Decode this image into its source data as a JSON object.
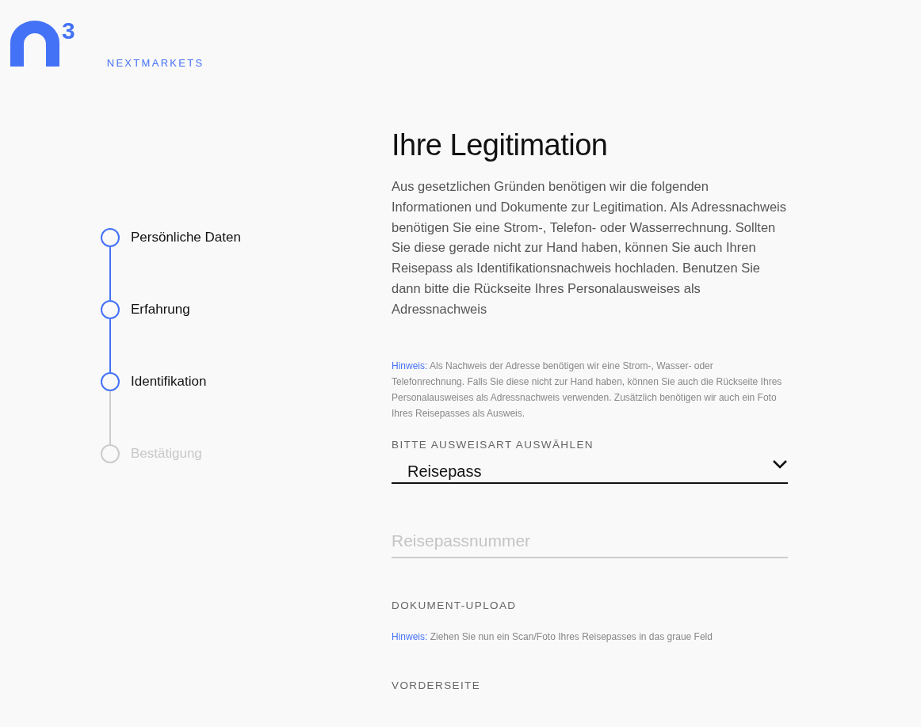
{
  "logo": {
    "superscript": "3",
    "wordmark": "NEXTMARKETS"
  },
  "steps": [
    {
      "label": "Persönliche Daten",
      "completed": true
    },
    {
      "label": "Erfahrung",
      "completed": true
    },
    {
      "label": "Identifikation",
      "completed": true
    },
    {
      "label": "Bestätigung",
      "completed": false
    }
  ],
  "title": "Ihre Legitimation",
  "intro": "Aus gesetzlichen Gründen benötigen wir die folgenden Informationen und Dokumente zur Legitimation. Als Adressnachweis benötigen Sie eine Strom-, Telefon- oder Wasserrechnung. Sollten Sie diese gerade nicht zur Hand haben, können Sie auch Ihren Reisepass als Identifikationsnachweis hochladen. Benutzen Sie dann bitte die Rückseite Ihres Personalausweises als Adressnachweis",
  "hint": {
    "label": "Hinweis:",
    "text": "Als Nachweis der Adresse benötigen wir eine Strom-, Wasser- oder Telefonrechnung. Falls Sie diese nicht zur Hand haben, können Sie auch die Rückseite Ihres Personalausweises als Adressnachweis verwenden. Zusätzlich benötigen wir auch ein Foto Ihres Reisepasses als Ausweis."
  },
  "id_type": {
    "label": "BITTE AUSWEISART AUSWÄHLEN",
    "value": "Reisepass"
  },
  "passport_number": {
    "placeholder": "Reisepassnummer"
  },
  "upload": {
    "label": "DOKUMENT-UPLOAD",
    "hint": {
      "label": "Hinweis:",
      "text": "Ziehen Sie nun ein Scan/Foto Ihres Reisepasses in das graue Feld"
    },
    "front_label": "VORDERSEITE"
  }
}
